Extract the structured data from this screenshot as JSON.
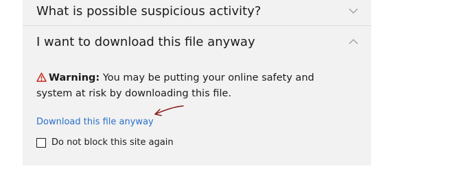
{
  "accordion": {
    "item1": {
      "label": "What is possible suspicious activity?",
      "icon": "chevron-down-icon"
    },
    "item2": {
      "label": "I want to download this file anyway",
      "icon": "chevron-up-icon",
      "content": {
        "warning_icon": "warning-triangle-icon",
        "warning_label": "Warning:",
        "warning_text": " You may be putting your online safety and system at risk by downloading this file.",
        "download_link": "Download this file anyway",
        "checkbox_label": "Do not block this site again",
        "checkbox_checked": false
      }
    }
  },
  "colors": {
    "panel_bg": "#f2f2f2",
    "link": "#2a6fc9",
    "warning_icon": "#c42b1c",
    "annotation_arrow": "#8b1a1a"
  }
}
